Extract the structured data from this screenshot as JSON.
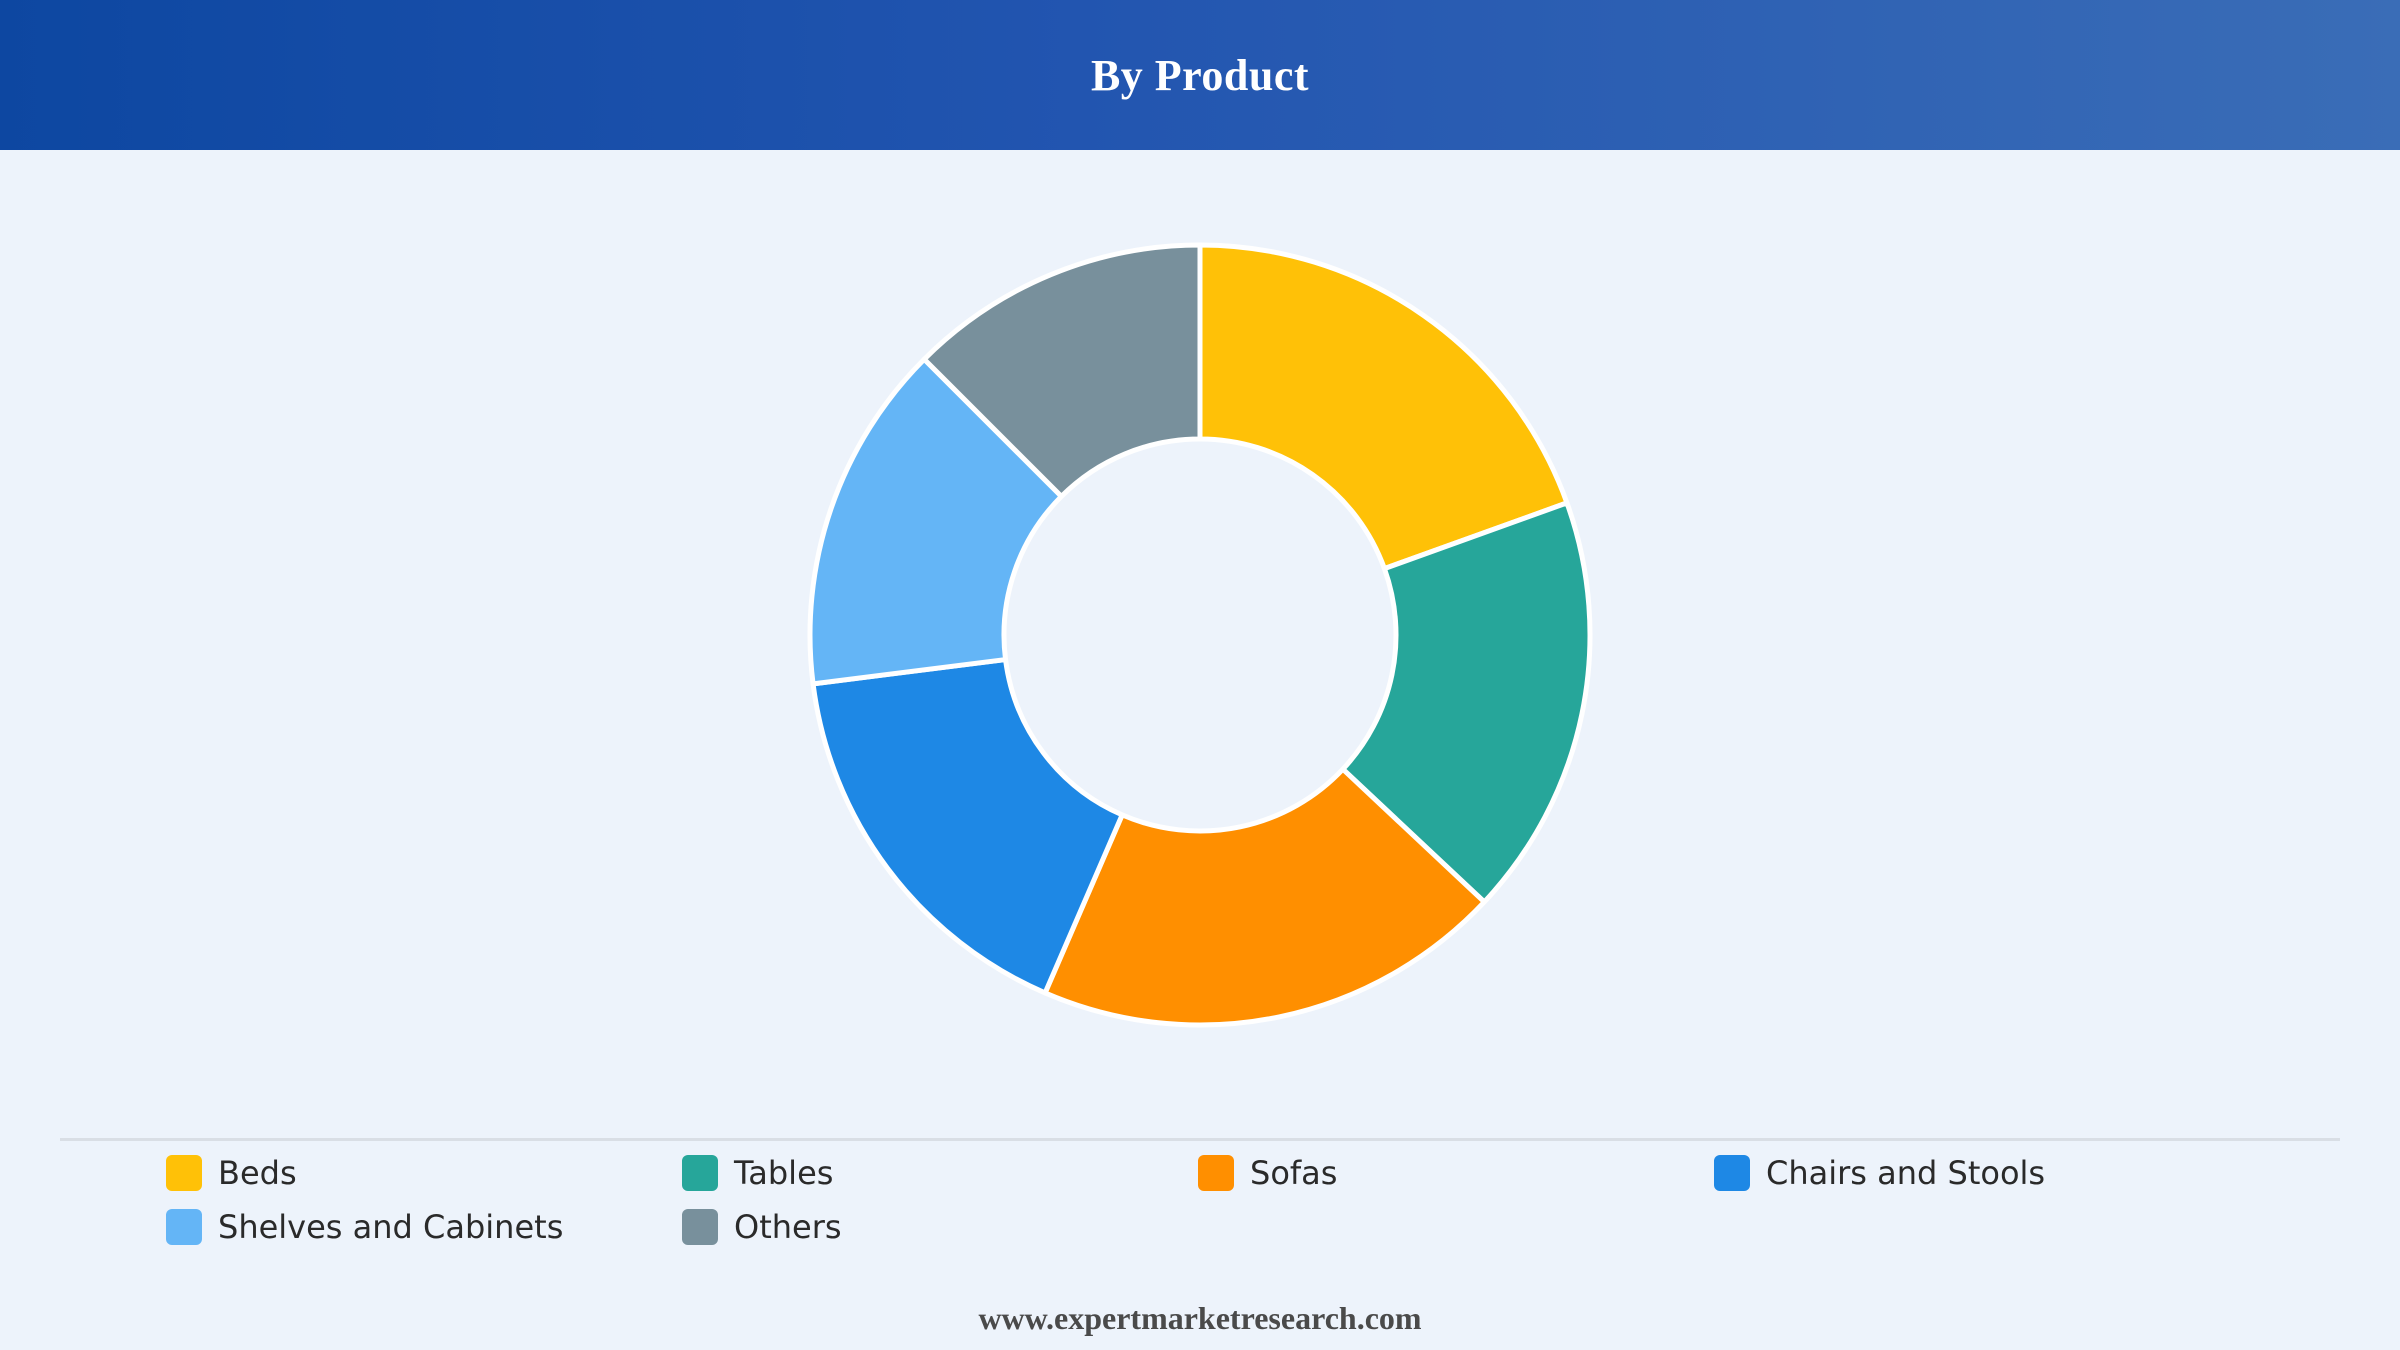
{
  "header": {
    "title": "By Product"
  },
  "chart_data": {
    "type": "pie",
    "variant": "donut",
    "title": "By Product",
    "categories": [
      "Beds",
      "Tables",
      "Sofas",
      "Chairs and Stools",
      "Shelves and Cabinets",
      "Others"
    ],
    "values": [
      19.5,
      17.5,
      19.5,
      16.5,
      14.5,
      12.5
    ],
    "unit": "%",
    "colors": [
      "#ffc107",
      "#26a69a",
      "#ff8f00",
      "#1e88e5",
      "#64b5f6",
      "#78909c"
    ],
    "legend_position": "bottom"
  },
  "footer": {
    "text": "www.expertmarketresearch.com"
  }
}
